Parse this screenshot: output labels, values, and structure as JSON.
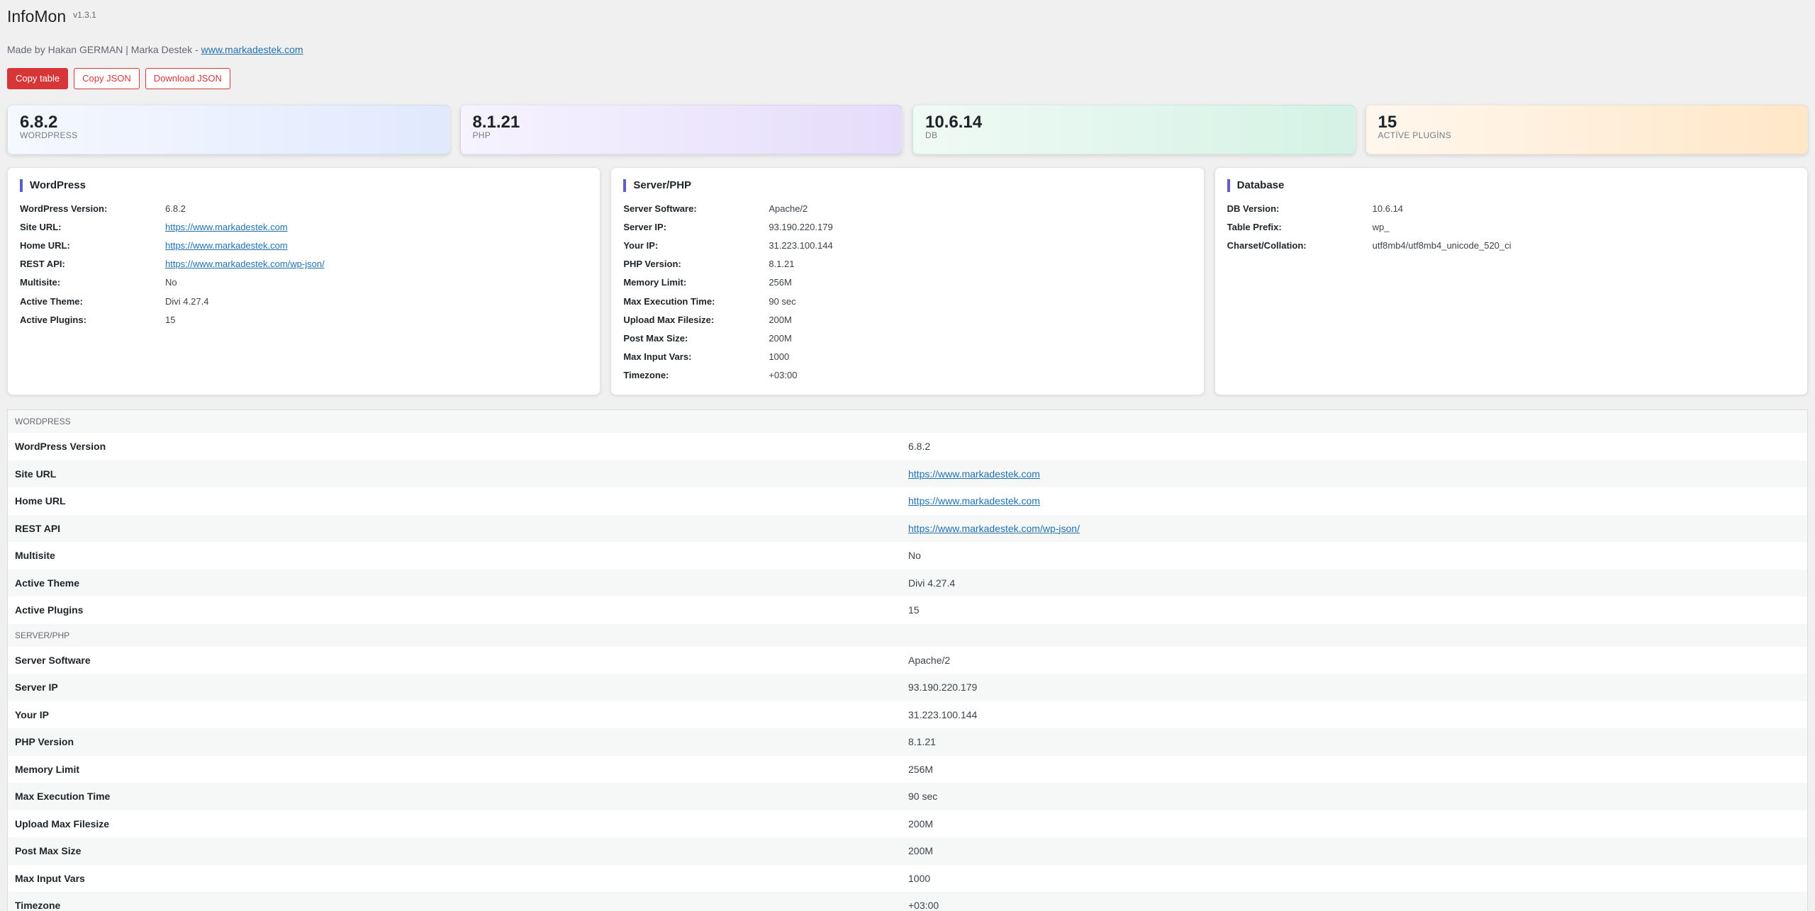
{
  "header": {
    "title": "InfoMon",
    "version": "v1.3.1",
    "byline_prefix": "Made by Hakan GERMAN | Marka Destek - ",
    "byline_link": "www.markadestek.com"
  },
  "buttons": {
    "copy_table": "Copy table",
    "copy_json": "Copy JSON",
    "download_json": "Download JSON"
  },
  "colors": {
    "accent": "#d63638",
    "link": "#2271b1",
    "panel_bar": "#5b5fc7"
  },
  "stats": [
    {
      "value": "6.8.2",
      "label": "WORDPRESS"
    },
    {
      "value": "8.1.21",
      "label": "PHP"
    },
    {
      "value": "10.6.14",
      "label": "DB"
    },
    {
      "value": "15",
      "label": "ACTİVE PLUGİNS"
    }
  ],
  "panels": {
    "wordpress": {
      "title": "WordPress",
      "rows": [
        {
          "key": "WordPress Version:",
          "value": "6.8.2"
        },
        {
          "key": "Site URL:",
          "value": "https://www.markadestek.com"
        },
        {
          "key": "Home URL:",
          "value": "https://www.markadestek.com"
        },
        {
          "key": "REST API:",
          "value": "https://www.markadestek.com/wp-json/"
        },
        {
          "key": "Multisite:",
          "value": "No"
        },
        {
          "key": "Active Theme:",
          "value": "Divi 4.27.4"
        },
        {
          "key": "Active Plugins:",
          "value": "15"
        }
      ]
    },
    "server": {
      "title": "Server/PHP",
      "rows": [
        {
          "key": "Server Software:",
          "value": "Apache/2"
        },
        {
          "key": "Server IP:",
          "value": "93.190.220.179"
        },
        {
          "key": "Your IP:",
          "value": "31.223.100.144"
        },
        {
          "key": "PHP Version:",
          "value": "8.1.21"
        },
        {
          "key": "Memory Limit:",
          "value": "256M"
        },
        {
          "key": "Max Execution Time:",
          "value": "90 sec"
        },
        {
          "key": "Upload Max Filesize:",
          "value": "200M"
        },
        {
          "key": "Post Max Size:",
          "value": "200M"
        },
        {
          "key": "Max Input Vars:",
          "value": "1000"
        },
        {
          "key": "Timezone:",
          "value": "+03:00"
        }
      ]
    },
    "database": {
      "title": "Database",
      "rows": [
        {
          "key": "DB Version:",
          "value": "10.6.14"
        },
        {
          "key": "Table Prefix:",
          "value": "wp_"
        },
        {
          "key": "Charset/Collation:",
          "value": "utf8mb4/utf8mb4_unicode_520_ci"
        }
      ]
    }
  },
  "table": {
    "section_wordpress": "WORDPRESS",
    "wordpress_rows": [
      {
        "key": "WordPress Version",
        "value": "6.8.2"
      },
      {
        "key": "Site URL",
        "value": "https://www.markadestek.com"
      },
      {
        "key": "Home URL",
        "value": "https://www.markadestek.com"
      },
      {
        "key": "REST API",
        "value": "https://www.markadestek.com/wp-json/"
      },
      {
        "key": "Multisite",
        "value": "No"
      },
      {
        "key": "Active Theme",
        "value": "Divi 4.27.4"
      },
      {
        "key": "Active Plugins",
        "value": "15"
      }
    ],
    "section_server": "SERVER/PHP",
    "server_rows": [
      {
        "key": "Server Software",
        "value": "Apache/2"
      },
      {
        "key": "Server IP",
        "value": "93.190.220.179"
      },
      {
        "key": "Your IP",
        "value": "31.223.100.144"
      },
      {
        "key": "PHP Version",
        "value": "8.1.21"
      },
      {
        "key": "Memory Limit",
        "value": "256M"
      },
      {
        "key": "Max Execution Time",
        "value": "90 sec"
      },
      {
        "key": "Upload Max Filesize",
        "value": "200M"
      },
      {
        "key": "Post Max Size",
        "value": "200M"
      },
      {
        "key": "Max Input Vars",
        "value": "1000"
      },
      {
        "key": "Timezone",
        "value": "+03:00"
      }
    ]
  }
}
